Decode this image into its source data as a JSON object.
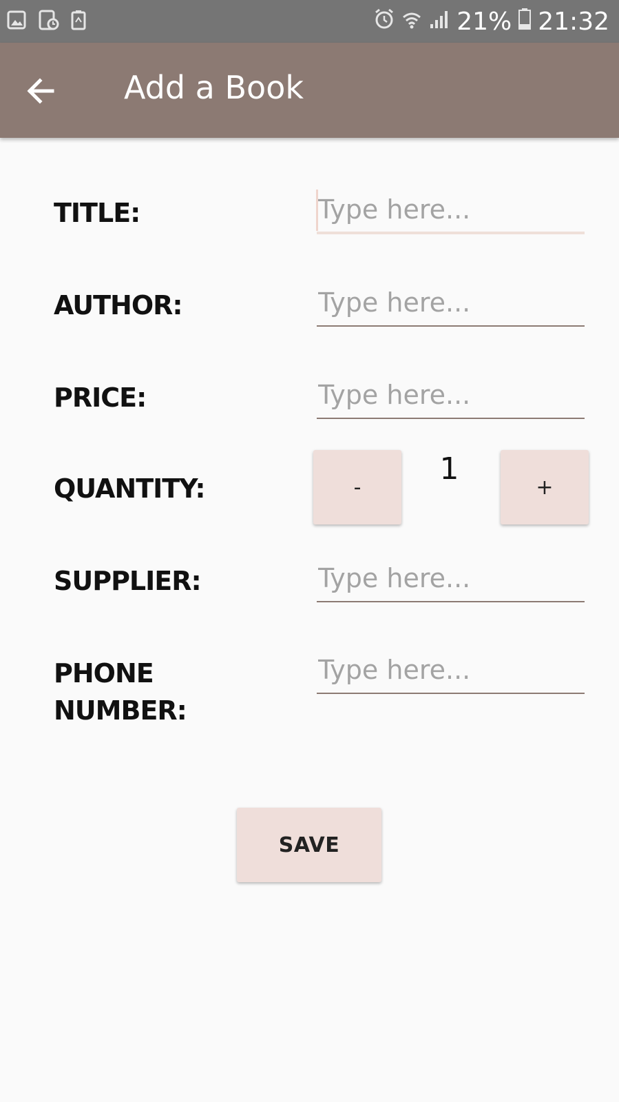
{
  "status_bar": {
    "left_icons": [
      "image-icon",
      "document-clock-icon",
      "recycle-battery-icon"
    ],
    "alarm_icon": "alarm-icon",
    "wifi_icon": "wifi-icon",
    "signal_icon": "signal-icon",
    "battery_percent": "21%",
    "battery_icon": "battery-icon",
    "time": "21:32"
  },
  "app_bar": {
    "back_icon": "arrow-left-icon",
    "title": "Add a Book",
    "color": "#8c7a73"
  },
  "form": {
    "title_label": "TITLE:",
    "author_label": "AUTHOR:",
    "price_label": "PRICE:",
    "quantity_label": "QUANTITY:",
    "supplier_label": "SUPPLIER:",
    "phone_label_line1": "PHONE",
    "phone_label_line2": "NUMBER:",
    "placeholder": "Type here...",
    "title_value": "",
    "author_value": "",
    "price_value": "",
    "supplier_value": "",
    "phone_value": ""
  },
  "quantity": {
    "decrement_label": "-",
    "value": "1",
    "increment_label": "+"
  },
  "save_label": "SAVE",
  "colors": {
    "button_bg": "#efdeda",
    "focus_underline": "#efdfd9",
    "background": "#fafafa"
  }
}
